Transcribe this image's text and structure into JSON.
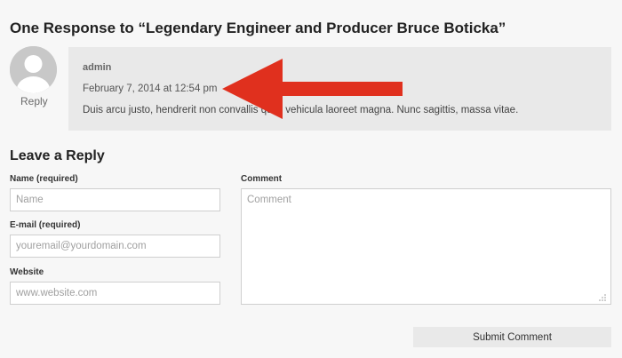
{
  "responses": {
    "title": "One Response to “Legendary Engineer and Producer Bruce Boticka”"
  },
  "comment": {
    "avatar_icon": "user-avatar-icon",
    "author": "admin",
    "date": "February 7, 2014 at 12:54 pm",
    "text": "Duis arcu justo, hendrerit non convallis quis, vehicula laoreet magna. Nunc sagittis, massa vitae.",
    "reply_label": "Reply"
  },
  "annotation": {
    "icon": "red-arrow-icon",
    "color": "#e0301e"
  },
  "reply_form": {
    "title": "Leave a Reply",
    "name_label": "Name (required)",
    "name_placeholder": "Name",
    "email_label": "E-mail (required)",
    "email_placeholder": "youremail@yourdomain.com",
    "website_label": "Website",
    "website_placeholder": "www.website.com",
    "comment_label": "Comment",
    "comment_placeholder": "Comment",
    "submit_label": "Submit Comment"
  }
}
